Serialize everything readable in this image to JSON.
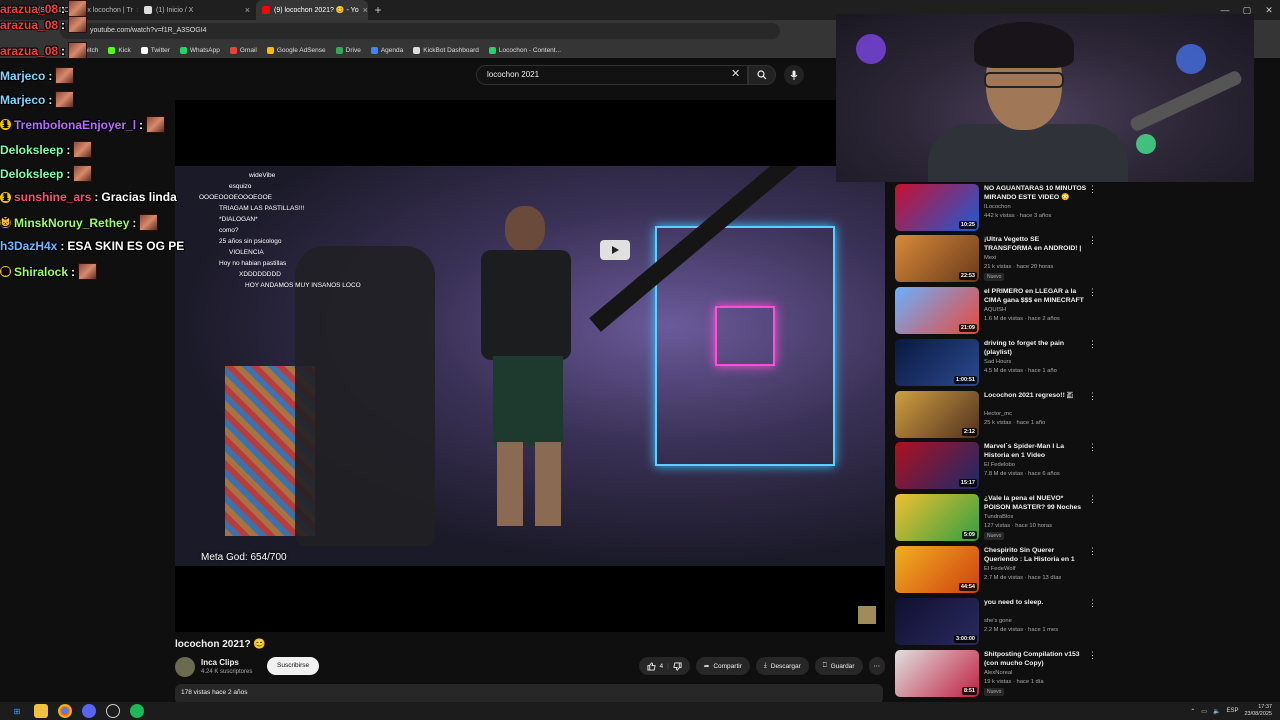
{
  "browser": {
    "tabs": [
      {
        "label": "(SÁBADO 23) ex locochon | Tr",
        "color": "#e33",
        "active": false
      },
      {
        "label": "(1) Inicio / X",
        "color": "#fff",
        "active": false
      },
      {
        "label": "(9) locochon 2021? 😊 - Yo",
        "color": "#f00",
        "active": true
      }
    ],
    "url": "youtube.com/watch?v=f1R_A3SOGI4",
    "bookmarks": [
      "Twitch",
      "Kick",
      "Twitter",
      "WhatsApp",
      "Gmail",
      "Google AdSense",
      "Drive",
      "Agenda",
      "KickBot Dashboard",
      "Locochon - Content..."
    ]
  },
  "youtube": {
    "search_query": "locochon 2021",
    "video": {
      "title": "locochon 2021? 😊",
      "overlay_meta": "Meta God: 654/700",
      "overlay_chat": [
        "wideVibe",
        "esquizo",
        "OOOEOOOEOOOEOOE",
        "TRIAGAM LAS PASTILLAS!!!",
        "*DIALOGAN*",
        "como?",
        "25 años sin psicologo",
        "VIOLENCIA",
        "Hoy no habian pastillas",
        "XDDDDDDDD",
        "HOY ANDAMOS MUY INSANOS LOCO"
      ]
    },
    "channel": {
      "name": "Inca Clips",
      "subs": "4.24 K suscriptores",
      "subscribe": "Suscribirse"
    },
    "actions": {
      "likes": "4",
      "share": "Compartir",
      "download": "Descargar",
      "save": "Guardar"
    },
    "description": "178 vistas  hace 2 años",
    "recommendations": [
      {
        "title": "NO AGUANTARAS 10 MINUTOS MIRANDO ESTE VIDEO 😳",
        "channel": "ILocochon",
        "meta": "442 k vistas · hace 3 años",
        "duration": "10:25",
        "new": "",
        "colors": [
          "#c8102e",
          "#1d5bd6"
        ]
      },
      {
        "title": "¡Ultra Vegetto SE TRANSFORMA en ANDROID! | Ultra Vegito ...",
        "channel": "Mexi",
        "meta": "21 k vistas · hace 20 horas",
        "duration": "22:53",
        "new": "Nuevo",
        "colors": [
          "#d88a3a",
          "#6a3a1a"
        ]
      },
      {
        "title": "el PRIMERO en LLEGAR a la CIMA gana $$$ en MINECRAFT",
        "channel": "AQUISH",
        "meta": "1.6 M de vistas · hace 2 años",
        "duration": "21:09",
        "new": "",
        "colors": [
          "#6ab0ff",
          "#e84a3a"
        ]
      },
      {
        "title": "driving to forget the pain (playlist)",
        "channel": "Sad Hours",
        "meta": "4.5 M de vistas · hace 1 año",
        "duration": "1:00:51",
        "new": "",
        "colors": [
          "#0a1840",
          "#2a4a90"
        ]
      },
      {
        "title": "Locochon 2021 regreso!! 🇪",
        "channel": "Hector_mc",
        "meta": "25 k vistas · hace 1 año",
        "duration": "2:12",
        "new": "",
        "colors": [
          "#d0a040",
          "#503020"
        ]
      },
      {
        "title": "Marvel´s Spider-Man I La Historia en 1 Video",
        "channel": "El Fedelobo",
        "meta": "7.8 M de vistas · hace 6 años",
        "duration": "15:17",
        "new": "",
        "colors": [
          "#b01020",
          "#1a2a6a"
        ]
      },
      {
        "title": "¿Vale la pena el NUEVO* POISON MASTER? 99 Noches ...",
        "channel": "TundraBlox",
        "meta": "127 vistas · hace 10 horas",
        "duration": "5:09",
        "new": "Nuevo",
        "colors": [
          "#f0c030",
          "#30a040"
        ]
      },
      {
        "title": "Chespirito Sin Querer Queriendo : La Historia en 1 Video",
        "channel": "El FedeWolf",
        "meta": "2.7 M de vistas · hace 13 días",
        "duration": "44:54",
        "new": "",
        "colors": [
          "#f0b020",
          "#d04010"
        ]
      },
      {
        "title": "you need to sleep.",
        "channel": "she's gone",
        "meta": "2.2 M de vistas · hace 1 mes",
        "duration": "3:00:00",
        "new": "",
        "colors": [
          "#101030",
          "#2a2a60"
        ]
      },
      {
        "title": "Shitposting Compilation v153 (con mucho Copy)",
        "channel": "AlexNoreal",
        "meta": "19 k vistas · hace 1 día",
        "duration": "8:51",
        "new": "Nuevo",
        "colors": [
          "#e0e0e0",
          "#c02040"
        ]
      }
    ]
  },
  "stream_chat": [
    {
      "user": "arazua_08",
      "msg": "",
      "color": "#ff3b3b",
      "badge": ""
    },
    {
      "user": "arazua_08",
      "msg": "",
      "color": "#ff3b3b",
      "badge": ""
    },
    {
      "user": "arazua_08",
      "msg": "",
      "color": "#ff3b3b",
      "badge": ""
    },
    {
      "user": "Marjeco",
      "msg": "",
      "color": "#7fd6ff",
      "badge": ""
    },
    {
      "user": "Marjeco",
      "msg": "",
      "color": "#7fd6ff",
      "badge": ""
    },
    {
      "user": "TrembolonaEnjoyer_l",
      "msg": "",
      "color": "#b96bff",
      "badge": "1"
    },
    {
      "user": "Deloksleep",
      "msg": "",
      "color": "#7dffa8",
      "badge": ""
    },
    {
      "user": "Deloksleep",
      "msg": "",
      "color": "#7dffa8",
      "badge": ""
    },
    {
      "user": "sunshine_ars",
      "msg": "Gracias linda",
      "color": "#ff4d7a",
      "badge": "1"
    },
    {
      "user": "MinskNoruy_Rethey",
      "msg": "",
      "color": "#9cff5a",
      "badge": "😺"
    },
    {
      "user": "h3DazH4x",
      "msg": "ESA SKIN ES OG PE",
      "color": "#6fb8ff",
      "badge": ""
    },
    {
      "user": "Shiralock",
      "msg": "",
      "color": "#9cff5a",
      "badge": "⬢"
    }
  ],
  "taskbar": {
    "lang": "ESP",
    "time": "17:37",
    "date": "23/08/2025"
  },
  "accent": "#ff0000"
}
